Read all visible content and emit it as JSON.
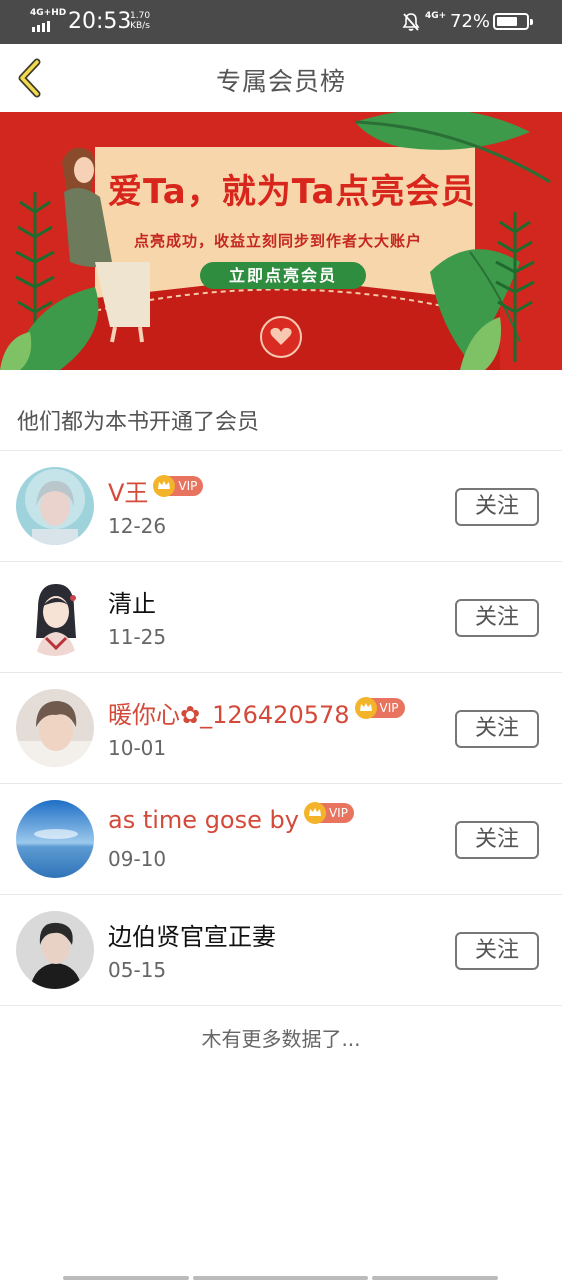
{
  "status_bar": {
    "network": "4G+HD",
    "time": "20:53",
    "speed_value": "1.70",
    "speed_unit": "KB/s",
    "network_right": "4G+",
    "battery_percent": "72%",
    "battery_level": 0.72
  },
  "header": {
    "title": "专属会员榜",
    "back_icon": "chevron-left-icon"
  },
  "banner": {
    "headline": "爱Ta，就为Ta点亮会员",
    "subtitle": "点亮成功，收益立刻同步到作者大大账户",
    "cta_label": "立即点亮会员"
  },
  "section": {
    "title": "他们都为本书开通了会员"
  },
  "members": [
    {
      "name": "V王",
      "date": "12-26",
      "vip": true,
      "vip_label": "VIP",
      "follow_label": "关注",
      "name_color": "#d34a3a"
    },
    {
      "name": "清止",
      "date": "11-25",
      "vip": false,
      "vip_label": "",
      "follow_label": "关注",
      "name_color": "#111111"
    },
    {
      "name": "暖你心✿_126420578",
      "date": "10-01",
      "vip": true,
      "vip_label": "VIP",
      "follow_label": "关注",
      "name_color": "#d34a3a"
    },
    {
      "name": "as time gose by",
      "date": "09-10",
      "vip": true,
      "vip_label": "VIP",
      "follow_label": "关注",
      "name_color": "#d34a3a"
    },
    {
      "name": "边伯贤官宣正妻",
      "date": "05-15",
      "vip": false,
      "vip_label": "",
      "follow_label": "关注",
      "name_color": "#111111"
    }
  ],
  "footer": {
    "no_more_text": "木有更多数据了..."
  },
  "colors": {
    "status_bar_bg": "#4a4a4a",
    "banner_red": "#d2271f",
    "vip_name": "#d34a3a",
    "cta_green": "#2e8d3f"
  }
}
